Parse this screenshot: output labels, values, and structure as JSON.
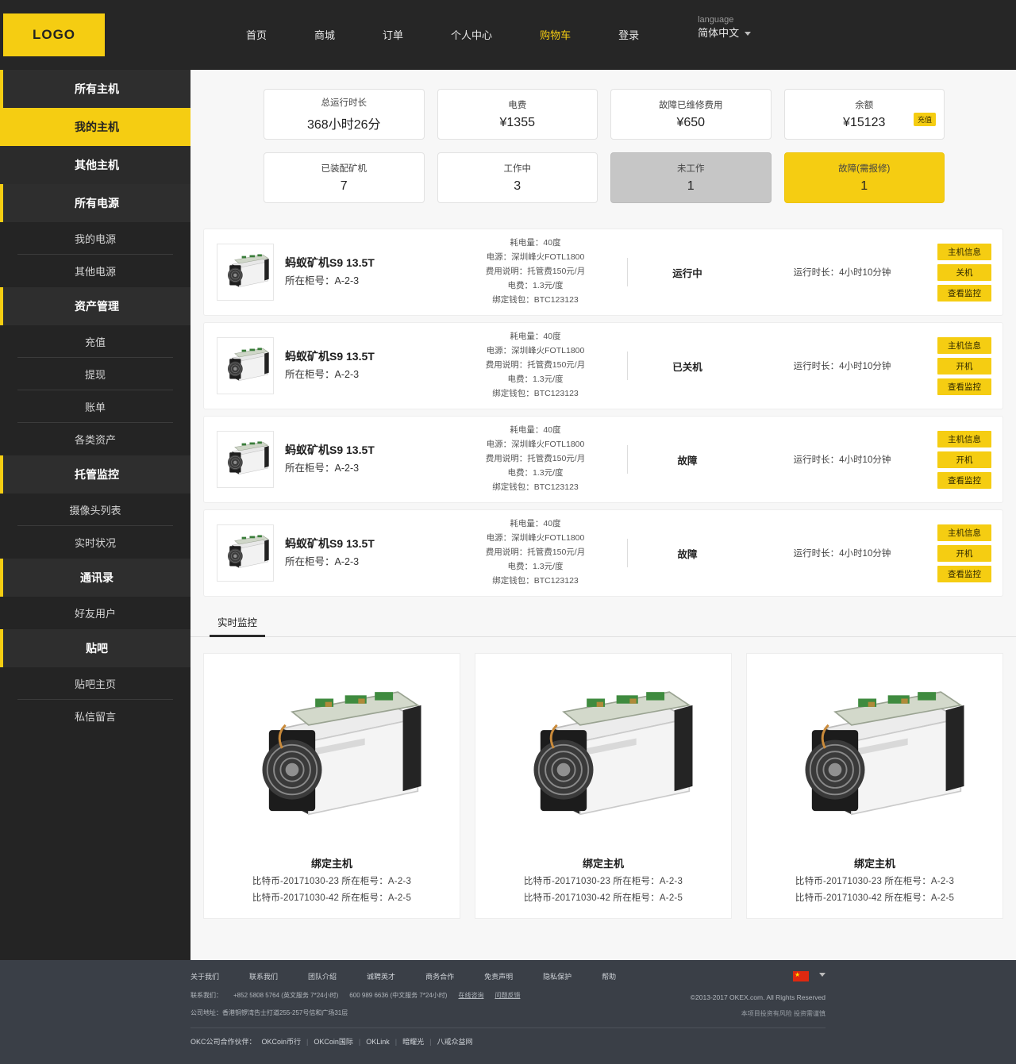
{
  "header": {
    "logo": "LOGO",
    "nav": [
      {
        "label": "首页",
        "active": false
      },
      {
        "label": "商城",
        "active": false
      },
      {
        "label": "订单",
        "active": false
      },
      {
        "label": "个人中心",
        "active": false
      },
      {
        "label": "购物车",
        "active": true
      },
      {
        "label": "登录",
        "active": false
      }
    ],
    "language_label": "language",
    "language_value": "简体中文"
  },
  "sidebar": {
    "items": [
      {
        "label": "所有主机",
        "type": "group",
        "active": false
      },
      {
        "label": "我的主机",
        "type": "group",
        "active": true
      },
      {
        "label": "其他主机",
        "type": "group-plain",
        "active": false
      },
      {
        "label": "所有电源",
        "type": "group",
        "active": false
      },
      {
        "label": "我的电源",
        "type": "sub",
        "divider": true
      },
      {
        "label": "其他电源",
        "type": "sub",
        "divider": false
      },
      {
        "label": "资产管理",
        "type": "group",
        "active": false
      },
      {
        "label": "充值",
        "type": "sub",
        "divider": true
      },
      {
        "label": "提现",
        "type": "sub",
        "divider": true
      },
      {
        "label": "账单",
        "type": "sub",
        "divider": true
      },
      {
        "label": "各类资产",
        "type": "sub",
        "divider": false
      },
      {
        "label": "托管监控",
        "type": "group",
        "active": false
      },
      {
        "label": "摄像头列表",
        "type": "sub",
        "divider": true
      },
      {
        "label": "实时状况",
        "type": "sub",
        "divider": false
      },
      {
        "label": "通讯录",
        "type": "group",
        "active": false
      },
      {
        "label": "好友用户",
        "type": "sub",
        "divider": false
      },
      {
        "label": "贴吧",
        "type": "group",
        "active": false
      },
      {
        "label": "贴吧主页",
        "type": "sub",
        "divider": true
      },
      {
        "label": "私信留言",
        "type": "sub",
        "divider": false
      }
    ]
  },
  "stats": {
    "row1": [
      {
        "label": "总运行时长",
        "value": "368小时26分",
        "style": "white",
        "badge": null
      },
      {
        "label": "电费",
        "value": "¥1355",
        "style": "white",
        "badge": null
      },
      {
        "label": "故障已维修费用",
        "value": "¥650",
        "style": "white",
        "badge": null
      },
      {
        "label": "余额",
        "value": "¥15123",
        "style": "white",
        "badge": "充值"
      }
    ],
    "row2": [
      {
        "label": "已装配矿机",
        "value": "7",
        "style": "white",
        "badge": null
      },
      {
        "label": "工作中",
        "value": "3",
        "style": "white",
        "badge": null
      },
      {
        "label": "未工作",
        "value": "1",
        "style": "gray",
        "badge": null
      },
      {
        "label": "故障(需报修)",
        "value": "1",
        "style": "yellow",
        "badge": null
      }
    ]
  },
  "machines": [
    {
      "name": "蚂蚁矿机S9 13.5T",
      "cabinet": "所在柜号：A-2-3",
      "specs": [
        "耗电量：40度",
        "电源：深圳峰火FOTL1800",
        "费用说明：托管费150元/月",
        "电费：1.3元/度",
        "绑定钱包：BTC123123"
      ],
      "status": "运行中",
      "runtime": "运行时长：4小时10分钟",
      "actions": [
        "主机信息",
        "关机",
        "查看监控"
      ]
    },
    {
      "name": "蚂蚁矿机S9 13.5T",
      "cabinet": "所在柜号：A-2-3",
      "specs": [
        "耗电量：40度",
        "电源：深圳峰火FOTL1800",
        "费用说明：托管费150元/月",
        "电费：1.3元/度",
        "绑定钱包：BTC123123"
      ],
      "status": "已关机",
      "runtime": "运行时长：4小时10分钟",
      "actions": [
        "主机信息",
        "开机",
        "查看监控"
      ]
    },
    {
      "name": "蚂蚁矿机S9 13.5T",
      "cabinet": "所在柜号：A-2-3",
      "specs": [
        "耗电量：40度",
        "电源：深圳峰火FOTL1800",
        "费用说明：托管费150元/月",
        "电费：1.3元/度",
        "绑定钱包：BTC123123"
      ],
      "status": "故障",
      "runtime": "运行时长：4小时10分钟",
      "actions": [
        "主机信息",
        "开机",
        "查看监控"
      ]
    },
    {
      "name": "蚂蚁矿机S9 13.5T",
      "cabinet": "所在柜号：A-2-3",
      "specs": [
        "耗电量：40度",
        "电源：深圳峰火FOTL1800",
        "费用说明：托管费150元/月",
        "电费：1.3元/度",
        "绑定钱包：BTC123123"
      ],
      "status": "故障",
      "runtime": "运行时长：4小时10分钟",
      "actions": [
        "主机信息",
        "开机",
        "查看监控"
      ]
    }
  ],
  "tabs": [
    {
      "label": "实时监控",
      "active": true
    }
  ],
  "monitors": [
    {
      "title": "绑定主机",
      "line1": "比特币-20171030-23  所在柜号：A-2-3",
      "line2": "比特币-20171030-42  所在柜号：A-2-5"
    },
    {
      "title": "绑定主机",
      "line1": "比特币-20171030-23  所在柜号：A-2-3",
      "line2": "比特币-20171030-42  所在柜号：A-2-5"
    },
    {
      "title": "绑定主机",
      "line1": "比特币-20171030-23  所在柜号：A-2-3",
      "line2": "比特币-20171030-42  所在柜号：A-2-5"
    }
  ],
  "footer": {
    "links": [
      "关于我们",
      "联系我们",
      "团队介绍",
      "诚聘英才",
      "商务合作",
      "免责声明",
      "隐私保护",
      "帮助"
    ],
    "contact_label": "联系我们：",
    "contact_en": "+852 5808 5764 (英文服务 7*24小时)",
    "contact_cn": "600 989 6636 (中文服务 7*24小时)",
    "contact_link1": "在线咨询",
    "contact_link2": "问题反馈",
    "address": "公司地址：香港铜锣湾告士打道255-257号信和广场31层",
    "partners_label": "OKC公司合作伙伴：",
    "partners": [
      "OKCoin币行",
      "OKCoin国际",
      "OKLink",
      "暗耀光",
      "八戒众益网"
    ],
    "copyright": "©2013-2017 OKEX.com. All Rights Reserved",
    "sub_right": "本项目投资有风险 投资需谨慎"
  },
  "colors": {
    "accent": "#f5cd12",
    "dark": "#262626",
    "sidebar": "#242424",
    "footer": "#3a3f47"
  }
}
